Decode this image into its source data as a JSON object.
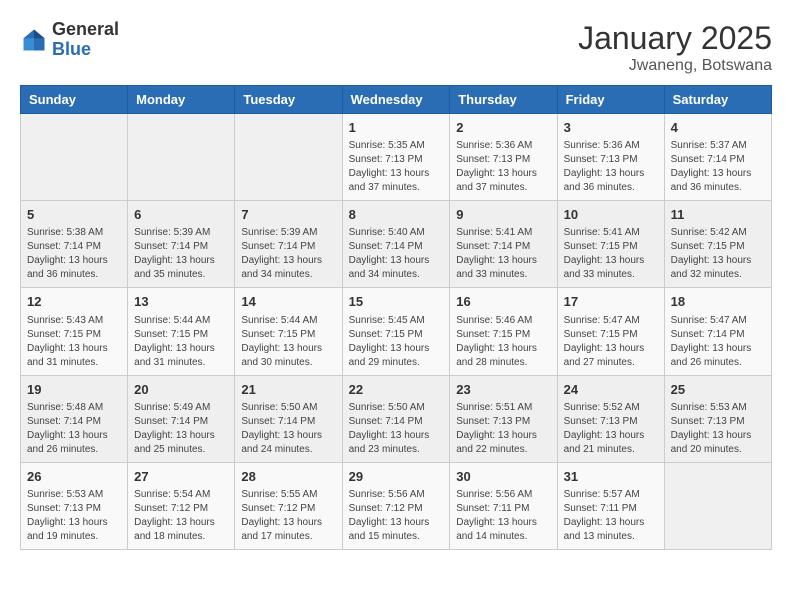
{
  "header": {
    "logo_general": "General",
    "logo_blue": "Blue",
    "title": "January 2025",
    "subtitle": "Jwaneng, Botswana"
  },
  "weekdays": [
    "Sunday",
    "Monday",
    "Tuesday",
    "Wednesday",
    "Thursday",
    "Friday",
    "Saturday"
  ],
  "weeks": [
    [
      {
        "day": "",
        "info": ""
      },
      {
        "day": "",
        "info": ""
      },
      {
        "day": "",
        "info": ""
      },
      {
        "day": "1",
        "info": "Sunrise: 5:35 AM\nSunset: 7:13 PM\nDaylight: 13 hours\nand 37 minutes."
      },
      {
        "day": "2",
        "info": "Sunrise: 5:36 AM\nSunset: 7:13 PM\nDaylight: 13 hours\nand 37 minutes."
      },
      {
        "day": "3",
        "info": "Sunrise: 5:36 AM\nSunset: 7:13 PM\nDaylight: 13 hours\nand 36 minutes."
      },
      {
        "day": "4",
        "info": "Sunrise: 5:37 AM\nSunset: 7:14 PM\nDaylight: 13 hours\nand 36 minutes."
      }
    ],
    [
      {
        "day": "5",
        "info": "Sunrise: 5:38 AM\nSunset: 7:14 PM\nDaylight: 13 hours\nand 36 minutes."
      },
      {
        "day": "6",
        "info": "Sunrise: 5:39 AM\nSunset: 7:14 PM\nDaylight: 13 hours\nand 35 minutes."
      },
      {
        "day": "7",
        "info": "Sunrise: 5:39 AM\nSunset: 7:14 PM\nDaylight: 13 hours\nand 34 minutes."
      },
      {
        "day": "8",
        "info": "Sunrise: 5:40 AM\nSunset: 7:14 PM\nDaylight: 13 hours\nand 34 minutes."
      },
      {
        "day": "9",
        "info": "Sunrise: 5:41 AM\nSunset: 7:14 PM\nDaylight: 13 hours\nand 33 minutes."
      },
      {
        "day": "10",
        "info": "Sunrise: 5:41 AM\nSunset: 7:15 PM\nDaylight: 13 hours\nand 33 minutes."
      },
      {
        "day": "11",
        "info": "Sunrise: 5:42 AM\nSunset: 7:15 PM\nDaylight: 13 hours\nand 32 minutes."
      }
    ],
    [
      {
        "day": "12",
        "info": "Sunrise: 5:43 AM\nSunset: 7:15 PM\nDaylight: 13 hours\nand 31 minutes."
      },
      {
        "day": "13",
        "info": "Sunrise: 5:44 AM\nSunset: 7:15 PM\nDaylight: 13 hours\nand 31 minutes."
      },
      {
        "day": "14",
        "info": "Sunrise: 5:44 AM\nSunset: 7:15 PM\nDaylight: 13 hours\nand 30 minutes."
      },
      {
        "day": "15",
        "info": "Sunrise: 5:45 AM\nSunset: 7:15 PM\nDaylight: 13 hours\nand 29 minutes."
      },
      {
        "day": "16",
        "info": "Sunrise: 5:46 AM\nSunset: 7:15 PM\nDaylight: 13 hours\nand 28 minutes."
      },
      {
        "day": "17",
        "info": "Sunrise: 5:47 AM\nSunset: 7:15 PM\nDaylight: 13 hours\nand 27 minutes."
      },
      {
        "day": "18",
        "info": "Sunrise: 5:47 AM\nSunset: 7:14 PM\nDaylight: 13 hours\nand 26 minutes."
      }
    ],
    [
      {
        "day": "19",
        "info": "Sunrise: 5:48 AM\nSunset: 7:14 PM\nDaylight: 13 hours\nand 26 minutes."
      },
      {
        "day": "20",
        "info": "Sunrise: 5:49 AM\nSunset: 7:14 PM\nDaylight: 13 hours\nand 25 minutes."
      },
      {
        "day": "21",
        "info": "Sunrise: 5:50 AM\nSunset: 7:14 PM\nDaylight: 13 hours\nand 24 minutes."
      },
      {
        "day": "22",
        "info": "Sunrise: 5:50 AM\nSunset: 7:14 PM\nDaylight: 13 hours\nand 23 minutes."
      },
      {
        "day": "23",
        "info": "Sunrise: 5:51 AM\nSunset: 7:13 PM\nDaylight: 13 hours\nand 22 minutes."
      },
      {
        "day": "24",
        "info": "Sunrise: 5:52 AM\nSunset: 7:13 PM\nDaylight: 13 hours\nand 21 minutes."
      },
      {
        "day": "25",
        "info": "Sunrise: 5:53 AM\nSunset: 7:13 PM\nDaylight: 13 hours\nand 20 minutes."
      }
    ],
    [
      {
        "day": "26",
        "info": "Sunrise: 5:53 AM\nSunset: 7:13 PM\nDaylight: 13 hours\nand 19 minutes."
      },
      {
        "day": "27",
        "info": "Sunrise: 5:54 AM\nSunset: 7:12 PM\nDaylight: 13 hours\nand 18 minutes."
      },
      {
        "day": "28",
        "info": "Sunrise: 5:55 AM\nSunset: 7:12 PM\nDaylight: 13 hours\nand 17 minutes."
      },
      {
        "day": "29",
        "info": "Sunrise: 5:56 AM\nSunset: 7:12 PM\nDaylight: 13 hours\nand 15 minutes."
      },
      {
        "day": "30",
        "info": "Sunrise: 5:56 AM\nSunset: 7:11 PM\nDaylight: 13 hours\nand 14 minutes."
      },
      {
        "day": "31",
        "info": "Sunrise: 5:57 AM\nSunset: 7:11 PM\nDaylight: 13 hours\nand 13 minutes."
      },
      {
        "day": "",
        "info": ""
      }
    ]
  ]
}
